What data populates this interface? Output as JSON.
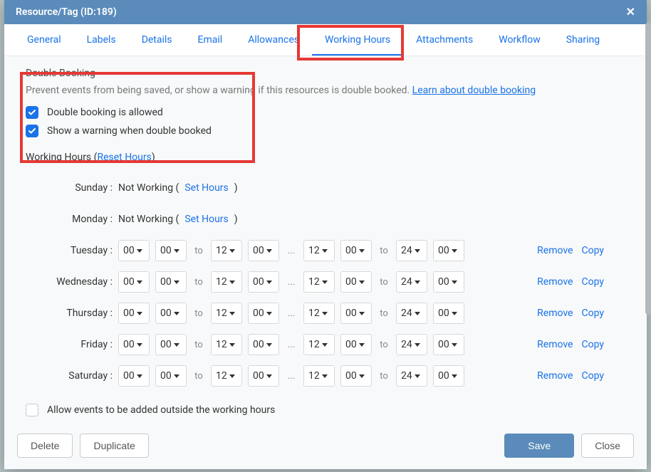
{
  "header": {
    "title": "Resource/Tag (ID:189)"
  },
  "tabs": [
    "General",
    "Labels",
    "Details",
    "Email",
    "Allowances",
    "Working Hours",
    "Attachments",
    "Workflow",
    "Sharing"
  ],
  "active_tab_index": 5,
  "double_booking": {
    "title": "Double Booking",
    "subtitle_pre": "Prevent events from being saved, or show a warning if this resources is double booked. ",
    "subtitle_link": "Learn about double booking",
    "allow_label": "Double booking is allowed",
    "warn_label": "Show a warning when double booked"
  },
  "working_hours": {
    "header_label": "Working Hours",
    "reset_label": "Reset Hours",
    "not_working": "Not Working",
    "set_hours": "Set Hours",
    "to_label": "to",
    "ellipsis": "...",
    "remove_label": "Remove",
    "copy_label": "Copy",
    "days": [
      {
        "name": "Sunday",
        "working": false
      },
      {
        "name": "Monday",
        "working": false
      },
      {
        "name": "Tuesday",
        "working": true,
        "slots": [
          [
            "00",
            "00",
            "12",
            "00"
          ],
          [
            "12",
            "00",
            "24",
            "00"
          ]
        ]
      },
      {
        "name": "Wednesday",
        "working": true,
        "slots": [
          [
            "00",
            "00",
            "12",
            "00"
          ],
          [
            "12",
            "00",
            "24",
            "00"
          ]
        ]
      },
      {
        "name": "Thursday",
        "working": true,
        "slots": [
          [
            "00",
            "00",
            "12",
            "00"
          ],
          [
            "12",
            "00",
            "24",
            "00"
          ]
        ]
      },
      {
        "name": "Friday",
        "working": true,
        "slots": [
          [
            "00",
            "00",
            "12",
            "00"
          ],
          [
            "12",
            "00",
            "24",
            "00"
          ]
        ]
      },
      {
        "name": "Saturday",
        "working": true,
        "slots": [
          [
            "00",
            "00",
            "12",
            "00"
          ],
          [
            "12",
            "00",
            "24",
            "00"
          ]
        ]
      }
    ],
    "allow_outside_label": "Allow events to be added outside the working hours"
  },
  "footer": {
    "delete": "Delete",
    "duplicate": "Duplicate",
    "save": "Save",
    "close": "Close"
  }
}
